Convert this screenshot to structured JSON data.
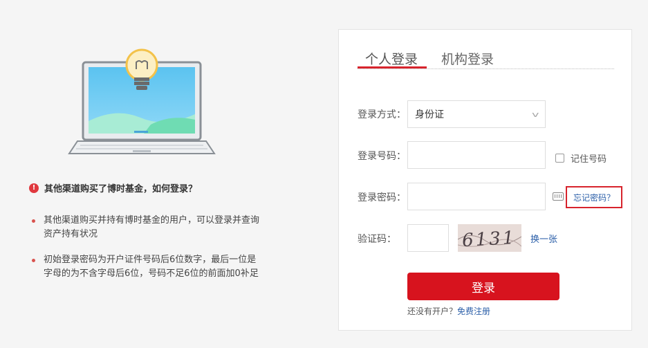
{
  "faq": {
    "title": "其他渠道购买了博时基金，如何登录？",
    "qicon": "!",
    "items": [
      "其他渠道购买并持有博时基金的用户，可以登录并查询资产持有状况",
      "初始登录密码为开户证件号码后6位数字，最后一位是字母的为不含字母后6位，号码不足6位的前面加0补足"
    ]
  },
  "login": {
    "tabs": [
      "个人登录",
      "机构登录"
    ],
    "active_tab": 0,
    "method_label": "登录方式：",
    "method_value": "身份证",
    "account_label": "登录号码：",
    "account_value": "",
    "remember_label": "记住号码",
    "password_label": "登录密码：",
    "password_value": "",
    "forgot_label": "忘记密码？",
    "captcha_label": "验证码：",
    "captcha_value": "",
    "captcha_text": "6131",
    "refresh_label": "换一张",
    "submit_label": "登录",
    "register_prompt": "还没有开户？",
    "register_link": "免费注册"
  },
  "colors": {
    "brand": "#d7131e",
    "link": "#2a5ea8",
    "highlight_border": "#d7232c"
  }
}
